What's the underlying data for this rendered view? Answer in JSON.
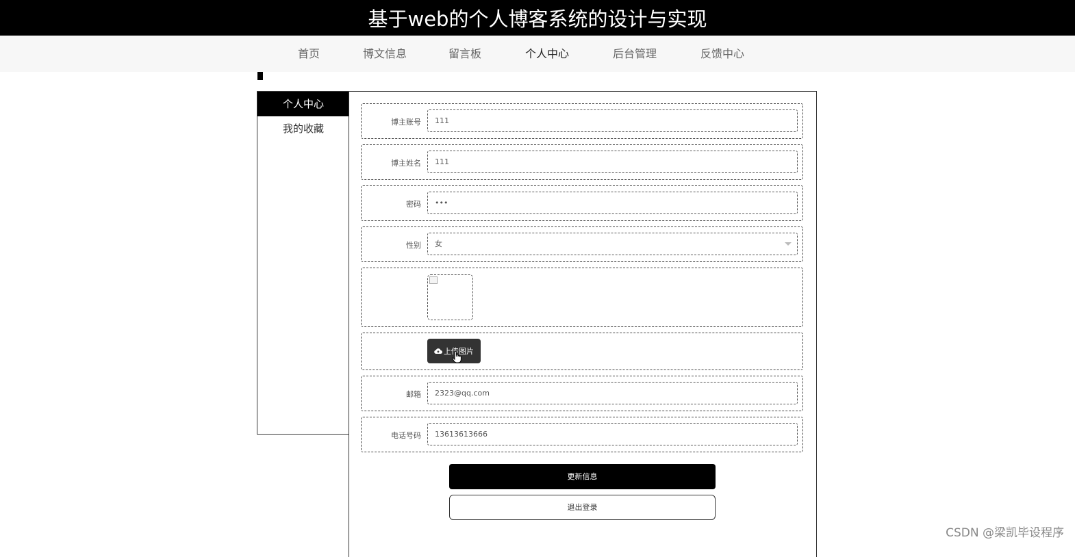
{
  "header": {
    "title": "基于web的个人博客系统的设计与实现"
  },
  "nav": {
    "items": [
      {
        "label": "首页"
      },
      {
        "label": "博文信息"
      },
      {
        "label": "留言板"
      },
      {
        "label": "个人中心",
        "active": true
      },
      {
        "label": "后台管理"
      },
      {
        "label": "反馈中心"
      }
    ]
  },
  "sidebar": {
    "items": [
      {
        "label": "个人中心",
        "active": true
      },
      {
        "label": "我的收藏"
      }
    ]
  },
  "form": {
    "account": {
      "label": "博主账号",
      "value": "111"
    },
    "name": {
      "label": "博主姓名",
      "value": "111"
    },
    "password": {
      "label": "密码",
      "value": "•••"
    },
    "gender": {
      "label": "性别",
      "value": "女"
    },
    "upload_label": "上传图片",
    "email": {
      "label": "邮箱",
      "value": "2323@qq.com"
    },
    "phone": {
      "label": "电话号码",
      "value": "13613613666"
    }
  },
  "actions": {
    "update": "更新信息",
    "logout": "退出登录"
  },
  "watermark": "CSDN @梁凯毕设程序",
  "colors": {
    "header_bg": "#000000",
    "nav_bg": "#f7f7f7",
    "primary_button": "#000000",
    "upload_button": "#333333"
  }
}
